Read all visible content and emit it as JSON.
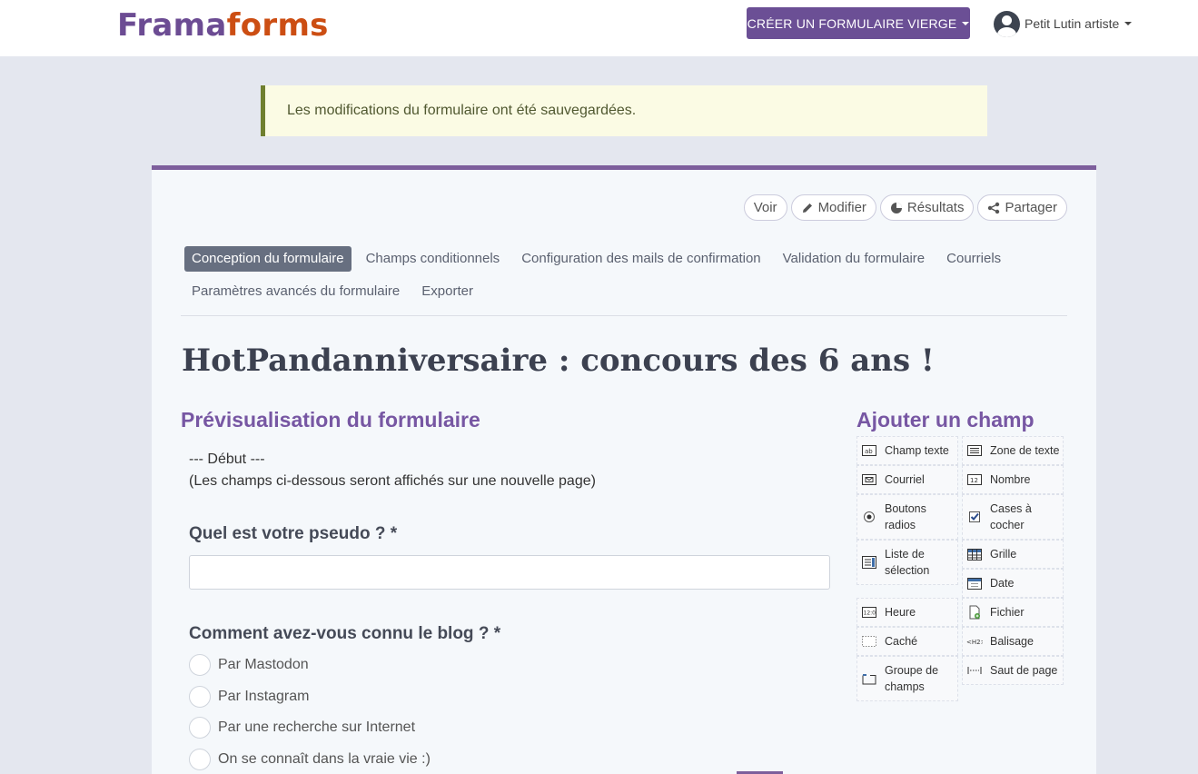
{
  "header": {
    "logo_part1": "Frama",
    "logo_part2": "forms",
    "create_button": "CRÉER UN FORMULAIRE VIERGE",
    "user_name": "Petit Lutin artiste"
  },
  "status_message": "Les modifications du formulaire ont été sauvegardées.",
  "actions": {
    "view": "Voir",
    "edit": "Modifier",
    "results": "Résultats",
    "share": "Partager"
  },
  "tabs": [
    {
      "label": "Conception du formulaire",
      "active": true
    },
    {
      "label": "Champs conditionnels"
    },
    {
      "label": "Configuration des mails de confirmation"
    },
    {
      "label": "Validation du formulaire"
    },
    {
      "label": "Courriels"
    },
    {
      "label": "Paramètres avancés du formulaire"
    },
    {
      "label": "Exporter"
    }
  ],
  "page_title": "HotPandanniversaire : concours des 6 ans !",
  "preview": {
    "title": "Prévisualisation du formulaire",
    "debut_line1": "--- Début ---",
    "debut_line2": "(Les champs ci-dessous seront affichés sur une nouvelle page)",
    "question1": "Quel est votre pseudo ? *",
    "question2": "Comment avez-vous connu le blog ? *",
    "options": [
      "Par Mastodon",
      "Par Instagram",
      "Par une recherche sur Internet",
      "On se connaît dans la vraie vie :)"
    ]
  },
  "palette": {
    "title": "Ajouter un champ",
    "items": {
      "textfield": "Champ texte",
      "textarea": "Zone de texte",
      "email": "Courriel",
      "number": "Nombre",
      "radios_1": "Boutons",
      "radios_2": "radios",
      "checkboxes_1": "Cases à",
      "checkboxes_2": "cocher",
      "select_1": "Liste de",
      "select_2": "sélection",
      "grid": "Grille",
      "date": "Date",
      "time": "Heure",
      "file": "Fichier",
      "hidden": "Caché",
      "markup": "Balisage",
      "fieldset_1": "Groupe de",
      "fieldset_2": "champs",
      "pagebreak": "Saut de page"
    },
    "icons": {
      "textfield": "text-field-icon",
      "textarea": "textarea-icon",
      "email": "email-icon",
      "number": "number-icon",
      "radios": "radio-icon",
      "checkboxes": "checkbox-icon",
      "select": "select-list-icon",
      "grid": "grid-icon",
      "date": "calendar-icon",
      "time": "clock-icon",
      "file": "file-icon",
      "hidden": "hidden-icon",
      "markup": "markup-icon",
      "fieldset": "fieldset-icon",
      "pagebreak": "page-break-icon"
    }
  },
  "colors": {
    "brand_purple": "#6b4f95",
    "brand_orange": "#cc4e13",
    "active_tab": "#676f80",
    "section_title": "#7757a3"
  }
}
